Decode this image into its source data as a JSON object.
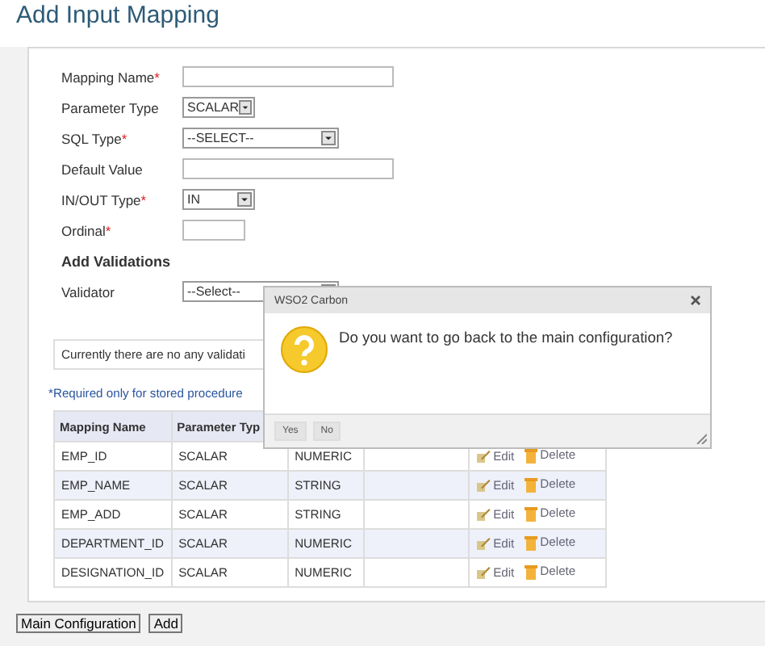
{
  "page": {
    "title": "Add Input Mapping"
  },
  "form": {
    "fields": [
      {
        "kind": "input",
        "label": "Mapping Name",
        "mark": "*"
      },
      {
        "kind": "short-select",
        "label": "Parameter Type",
        "value": "SCALAR"
      },
      {
        "kind": "select",
        "label": "SQL Type",
        "mark": "*",
        "value": "--SELECT--"
      },
      {
        "kind": "input",
        "label": "Default Value"
      },
      {
        "kind": "short-select",
        "label": "IN/OUT Type",
        "mark": "*",
        "value": "IN"
      },
      {
        "kind": "short-input",
        "label": "Ordinal",
        "mark": "*"
      },
      {
        "kind": "heading",
        "label": "Add Validations"
      },
      {
        "kind": "select",
        "label": "Validator",
        "value": "--Select--"
      }
    ]
  },
  "validation_message": "Currently there are no any validati",
  "required_note": "*Required only for stored procedure",
  "table": {
    "columns": [
      "Mapping Name",
      "Parameter Typ"
    ],
    "rows": [
      {
        "cells": [
          "EMP_ID",
          "SCALAR",
          "NUMERIC"
        ],
        "actions": [
          "Edit",
          "Delete"
        ]
      },
      {
        "cells": [
          "EMP_NAME",
          "SCALAR",
          "STRING"
        ],
        "actions": [
          "Edit",
          "Delete"
        ]
      },
      {
        "cells": [
          "EMP_ADD",
          "SCALAR",
          "STRING"
        ],
        "actions": [
          "Edit",
          "Delete"
        ]
      },
      {
        "cells": [
          "DEPARTMENT_ID",
          "SCALAR",
          "NUMERIC"
        ],
        "actions": [
          "Edit",
          "Delete"
        ]
      },
      {
        "cells": [
          "DESIGNATION_ID",
          "SCALAR",
          "NUMERIC"
        ],
        "actions": [
          "Edit",
          "Delete"
        ]
      }
    ]
  },
  "footer_buttons": [
    "Main Configuration",
    "Add"
  ],
  "dialog": {
    "title": "WSO2 Carbon",
    "message": "Do you want to go back to the main configuration?",
    "buttons": [
      "Yes",
      "No"
    ]
  }
}
